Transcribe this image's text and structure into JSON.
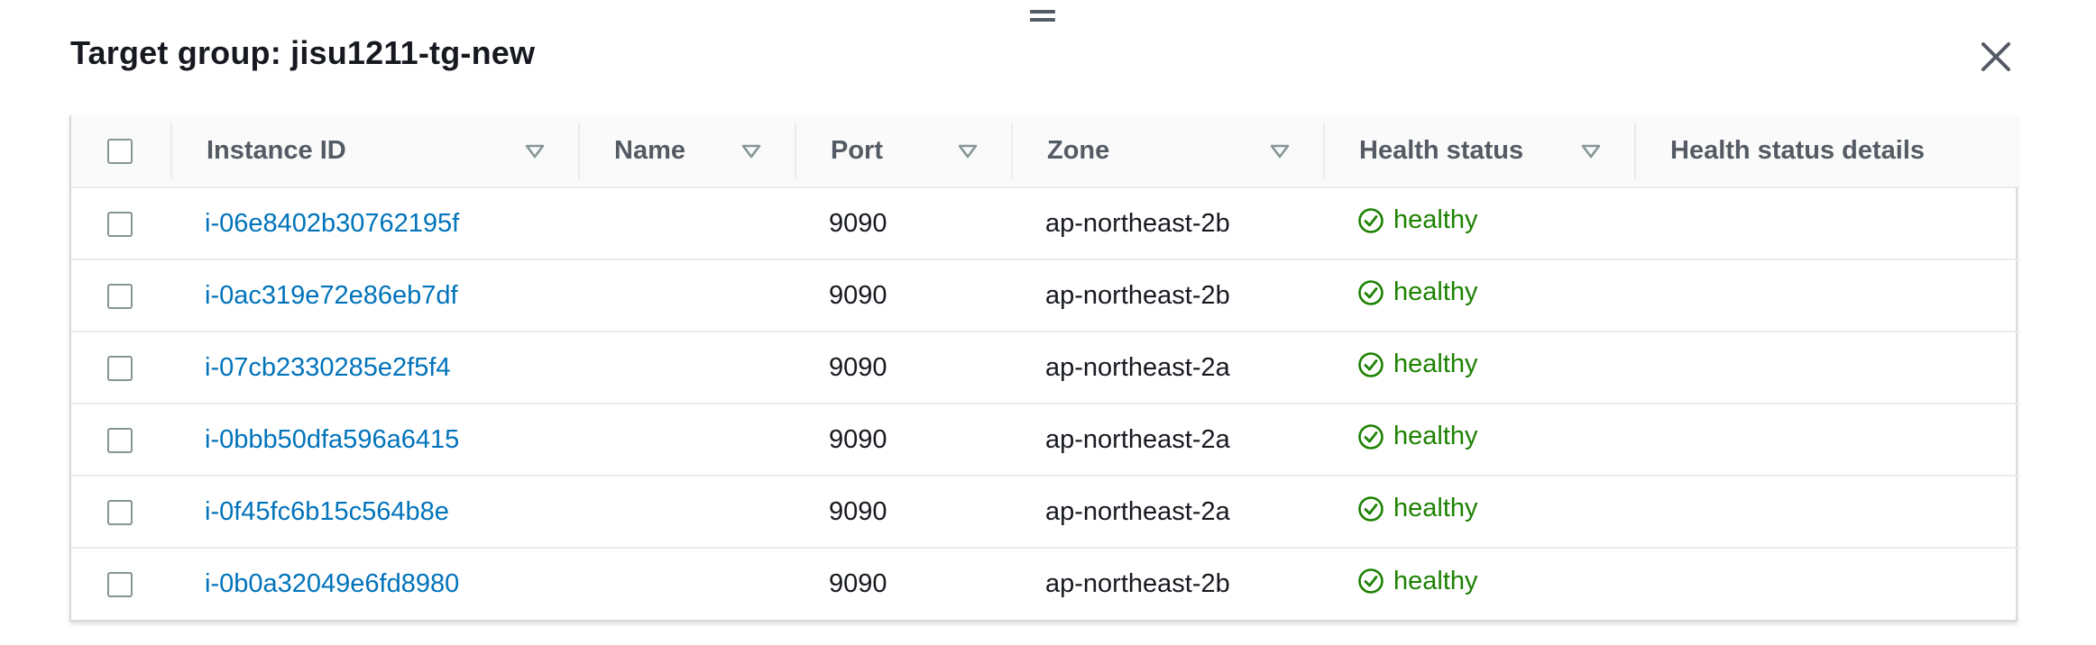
{
  "panel": {
    "title": "Target group: jisu1211-tg-new"
  },
  "table": {
    "columns": [
      {
        "key": "instance_id",
        "label": "Instance ID",
        "sortable": true
      },
      {
        "key": "name",
        "label": "Name",
        "sortable": true
      },
      {
        "key": "port",
        "label": "Port",
        "sortable": true
      },
      {
        "key": "zone",
        "label": "Zone",
        "sortable": true
      },
      {
        "key": "health_status",
        "label": "Health status",
        "sortable": true
      },
      {
        "key": "health_status_details",
        "label": "Health status details",
        "sortable": false
      }
    ],
    "rows": [
      {
        "instance_id": "i-06e8402b30762195f",
        "name": "",
        "port": "9090",
        "zone": "ap-northeast-2b",
        "health_status": "healthy",
        "health_status_details": ""
      },
      {
        "instance_id": "i-0ac319e72e86eb7df",
        "name": "",
        "port": "9090",
        "zone": "ap-northeast-2b",
        "health_status": "healthy",
        "health_status_details": ""
      },
      {
        "instance_id": "i-07cb2330285e2f5f4",
        "name": "",
        "port": "9090",
        "zone": "ap-northeast-2a",
        "health_status": "healthy",
        "health_status_details": ""
      },
      {
        "instance_id": "i-0bbb50dfa596a6415",
        "name": "",
        "port": "9090",
        "zone": "ap-northeast-2a",
        "health_status": "healthy",
        "health_status_details": ""
      },
      {
        "instance_id": "i-0f45fc6b15c564b8e",
        "name": "",
        "port": "9090",
        "zone": "ap-northeast-2a",
        "health_status": "healthy",
        "health_status_details": ""
      },
      {
        "instance_id": "i-0b0a32049e6fd8980",
        "name": "",
        "port": "9090",
        "zone": "ap-northeast-2b",
        "health_status": "healthy",
        "health_status_details": ""
      }
    ]
  },
  "icons": {
    "drag": "drag-handle-icon",
    "close": "close-icon",
    "sort": "sort-caret-icon",
    "healthy": "check-circle-icon"
  },
  "colors": {
    "link": "#0073bb",
    "healthy": "#1d8102",
    "header_text": "#545b64"
  }
}
